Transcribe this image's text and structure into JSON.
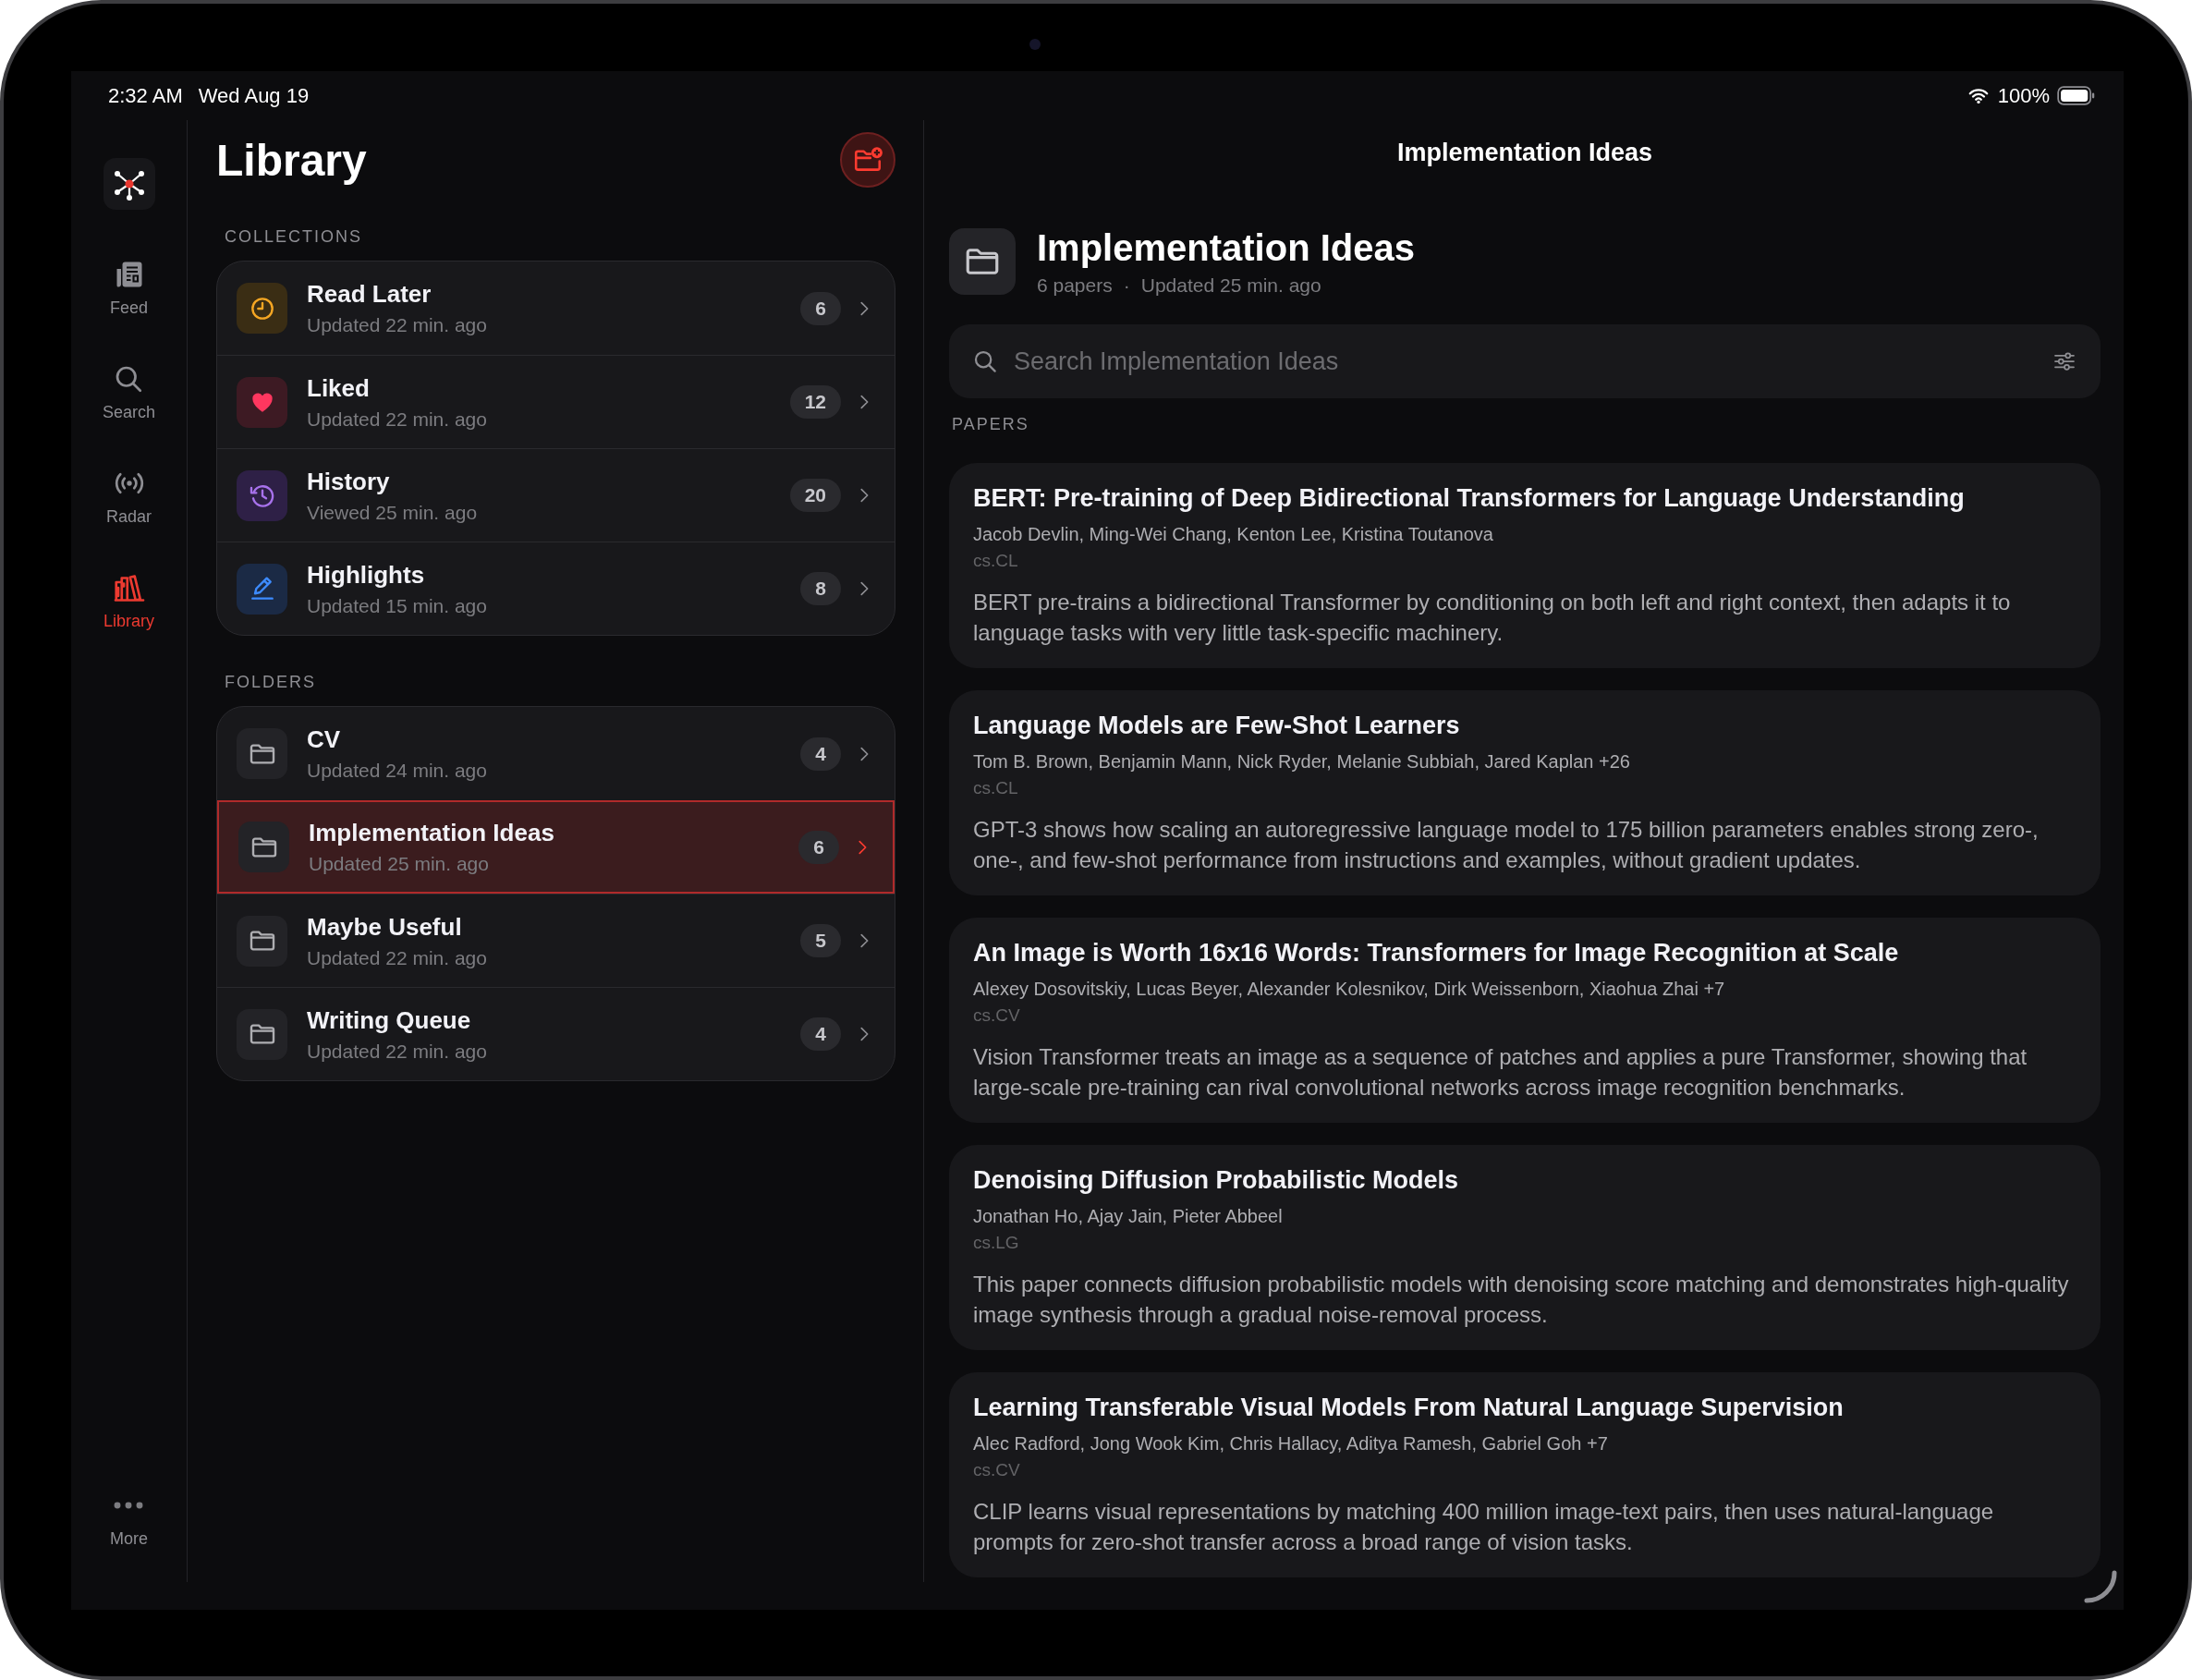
{
  "status_bar": {
    "time": "2:32 AM",
    "date": "Wed Aug 19",
    "battery": "100%"
  },
  "rail": {
    "items": [
      {
        "label": "Feed",
        "kind": "feed",
        "selected": false
      },
      {
        "label": "Search",
        "kind": "search",
        "selected": false
      },
      {
        "label": "Radar",
        "kind": "radar",
        "selected": false
      },
      {
        "label": "Library",
        "kind": "library",
        "selected": true
      }
    ],
    "more": {
      "label": "More"
    }
  },
  "library": {
    "title": "Library",
    "sections": [
      {
        "header": "COLLECTIONS",
        "items": [
          {
            "name": "Read Later",
            "subtitle": "Updated 22 min. ago",
            "count": "6",
            "kind": "clock",
            "selected": false
          },
          {
            "name": "Liked",
            "subtitle": "Updated 22 min. ago",
            "count": "12",
            "kind": "heart",
            "selected": false
          },
          {
            "name": "History",
            "subtitle": "Viewed 25 min. ago",
            "count": "20",
            "kind": "history",
            "selected": false
          },
          {
            "name": "Highlights",
            "subtitle": "Updated 15 min. ago",
            "count": "8",
            "kind": "pencil",
            "selected": false
          }
        ]
      },
      {
        "header": "FOLDERS",
        "items": [
          {
            "name": "CV",
            "subtitle": "Updated 24 min. ago",
            "count": "4",
            "kind": "folder",
            "selected": false
          },
          {
            "name": "Implementation Ideas",
            "subtitle": "Updated 25 min. ago",
            "count": "6",
            "kind": "folder",
            "selected": true
          },
          {
            "name": "Maybe Useful",
            "subtitle": "Updated 22 min. ago",
            "count": "5",
            "kind": "folder",
            "selected": false
          },
          {
            "name": "Writing Queue",
            "subtitle": "Updated 22 min. ago",
            "count": "4",
            "kind": "folder",
            "selected": false
          }
        ]
      }
    ]
  },
  "detail": {
    "nav_title": "Implementation Ideas",
    "header": {
      "title": "Implementation Ideas",
      "paper_count": "6 papers",
      "separator": "·",
      "updated": "Updated 25 min. ago"
    },
    "search": {
      "placeholder": "Search Implementation Ideas"
    },
    "section_label": "PAPERS",
    "papers": [
      {
        "title": "BERT: Pre-training of Deep Bidirectional Transformers for Language Understanding",
        "authors": "Jacob Devlin, Ming-Wei Chang, Kenton Lee, Kristina Toutanova",
        "category": "cs.CL",
        "abstract": "BERT pre-trains a bidirectional Transformer by conditioning on both left and right context, then adapts it to language tasks with very little task-specific machinery."
      },
      {
        "title": "Language Models are Few-Shot Learners",
        "authors": "Tom B. Brown, Benjamin Mann, Nick Ryder, Melanie Subbiah, Jared Kaplan +26",
        "category": "cs.CL",
        "abstract": "GPT-3 shows how scaling an autoregressive language model to 175 billion parameters enables strong zero-, one-, and few-shot performance from instructions and examples, without gradient updates."
      },
      {
        "title": "An Image is Worth 16x16 Words: Transformers for Image Recognition at Scale",
        "authors": "Alexey Dosovitskiy, Lucas Beyer, Alexander Kolesnikov, Dirk Weissenborn, Xiaohua Zhai +7",
        "category": "cs.CV",
        "abstract": "Vision Transformer treats an image as a sequence of patches and applies a pure Transformer, showing that large-scale pre-training can rival convolutional networks across image recognition benchmarks."
      },
      {
        "title": "Denoising Diffusion Probabilistic Models",
        "authors": "Jonathan Ho, Ajay Jain, Pieter Abbeel",
        "category": "cs.LG",
        "abstract": "This paper connects diffusion probabilistic models with denoising score matching and demonstrates high-quality image synthesis through a gradual noise-removal process."
      },
      {
        "title": "Learning Transferable Visual Models From Natural Language Supervision",
        "authors": "Alec Radford, Jong Wook Kim, Chris Hallacy, Aditya Ramesh, Gabriel Goh +7",
        "category": "cs.CV",
        "abstract": "CLIP learns visual representations by matching 400 million image-text pairs, then uses natural-language prompts for zero-shot transfer across a broad range of vision tasks."
      }
    ]
  }
}
